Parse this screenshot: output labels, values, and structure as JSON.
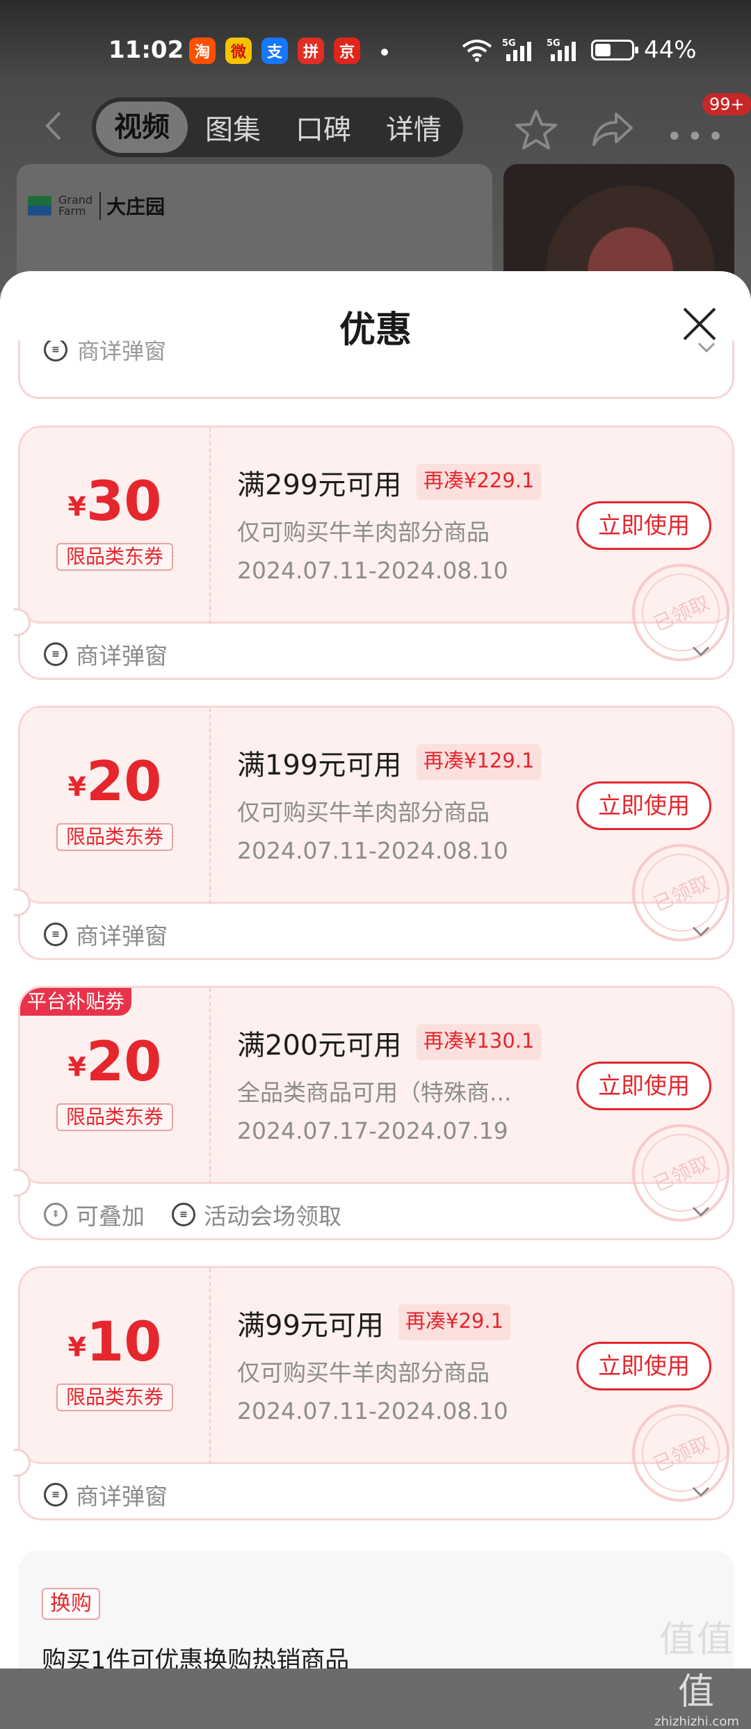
{
  "status_bar": {
    "time": "11:02",
    "apps": [
      {
        "icon": "taobao-icon",
        "glyph": "淘",
        "color": "#ff5000"
      },
      {
        "icon": "weibo-icon",
        "glyph": "微",
        "color": "#f5c400"
      },
      {
        "icon": "alipay-icon",
        "glyph": "支",
        "color": "#1677ff"
      },
      {
        "icon": "pinduoduo-icon",
        "glyph": "拼",
        "color": "#e02e24"
      },
      {
        "icon": "jd-icon",
        "glyph": "京",
        "color": "#e1251b"
      }
    ],
    "network": "5G",
    "battery": "44%"
  },
  "nav": {
    "tabs": [
      "视频",
      "图集",
      "口碑",
      "详情"
    ],
    "active_tab": 0,
    "badge": "99+"
  },
  "product": {
    "brand_en_line1": "Grand",
    "brand_en_line2": "Farm",
    "brand_cn": "大庄园"
  },
  "sheet": {
    "title": "优惠",
    "partial_label": "商详弹窗"
  },
  "coupons": [
    {
      "amount": "30",
      "currency": "¥",
      "type_tag": "限品类东券",
      "threshold": "满299元可用",
      "extra": "再凑¥229.1",
      "scope": "仅可购买牛羊肉部分商品",
      "dates": "2024.07.11-2024.08.10",
      "button": "立即使用",
      "stamp": "已领取",
      "source": "商详弹窗"
    },
    {
      "amount": "20",
      "currency": "¥",
      "type_tag": "限品类东券",
      "threshold": "满199元可用",
      "extra": "再凑¥129.1",
      "scope": "仅可购买牛羊肉部分商品",
      "dates": "2024.07.11-2024.08.10",
      "button": "立即使用",
      "stamp": "已领取",
      "source": "商详弹窗"
    },
    {
      "platform_tag": "平台补贴券",
      "amount": "20",
      "currency": "¥",
      "type_tag": "限品类东券",
      "threshold": "满200元可用",
      "extra": "再凑¥130.1",
      "scope": "全品类商品可用（特殊商...",
      "dates": "2024.07.17-2024.07.19",
      "button": "立即使用",
      "stamp": "已领取",
      "stackable": "可叠加",
      "source": "活动会场领取"
    },
    {
      "amount": "10",
      "currency": "¥",
      "type_tag": "限品类东券",
      "threshold": "满99元可用",
      "extra": "再凑¥29.1",
      "scope": "仅可购买牛羊肉部分商品",
      "dates": "2024.07.11-2024.08.10",
      "button": "立即使用",
      "stamp": "已领取",
      "source": "商详弹窗"
    }
  ],
  "exchange": {
    "tag": "换购",
    "desc": "购买1件可优惠换购热销商品"
  },
  "watermark": {
    "big": "值值值",
    "small": "zhizhizhi.com"
  },
  "colors": {
    "accent": "#e5262d",
    "coupon_bg": "#fdf0ef",
    "coupon_border": "#f8d6d6"
  }
}
